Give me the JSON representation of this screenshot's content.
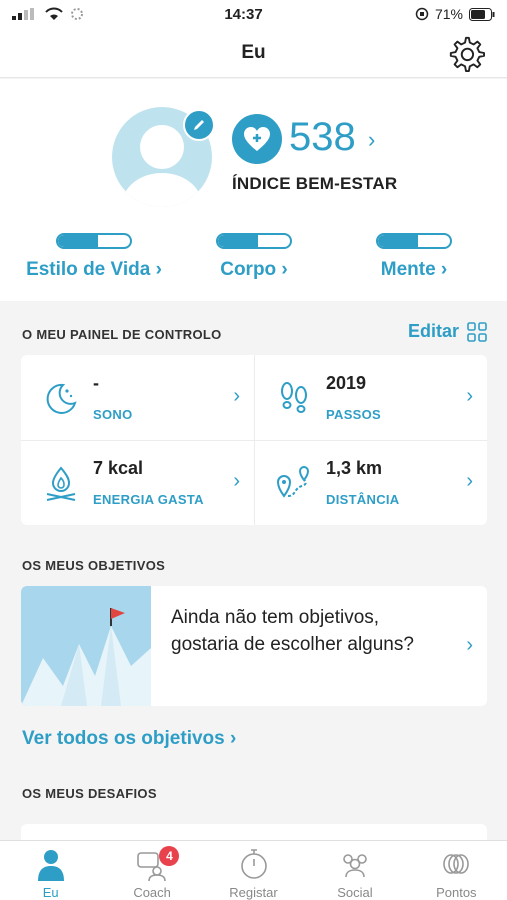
{
  "status": {
    "time": "14:37",
    "battery": "71%"
  },
  "nav": {
    "title": "Eu"
  },
  "profile": {
    "score": "538",
    "score_label": "ÍNDICE BEM-ESTAR"
  },
  "categories": [
    {
      "label": "Estilo de Vida ›",
      "fill": 0.55
    },
    {
      "label": "Corpo ›",
      "fill": 0.55
    },
    {
      "label": "Mente ›",
      "fill": 0.55
    }
  ],
  "dashboard": {
    "title": "O MEU PAINEL DE CONTROLO",
    "edit_label": "Editar",
    "items": [
      {
        "value": "-",
        "label": "SONO",
        "icon": "sleep-icon"
      },
      {
        "value": "2019",
        "label": "PASSOS",
        "icon": "footsteps-icon"
      },
      {
        "value": "7 kcal",
        "label": "ENERGIA GASTA",
        "icon": "fire-icon"
      },
      {
        "value": "1,3 km",
        "label": "DISTÂNCIA",
        "icon": "distance-icon"
      }
    ]
  },
  "goals": {
    "title": "OS MEUS OBJETIVOS",
    "empty_text": "Ainda não tem objetivos, gostaria de escolher alguns?",
    "see_all": "Ver todos os objetivos ›"
  },
  "challenges": {
    "title": "OS MEUS DESAFIOS"
  },
  "tabs": [
    {
      "label": "Eu",
      "icon": "person-icon",
      "active": true
    },
    {
      "label": "Coach",
      "icon": "coach-icon",
      "badge": "4"
    },
    {
      "label": "Registar",
      "icon": "stopwatch-icon"
    },
    {
      "label": "Social",
      "icon": "group-icon"
    },
    {
      "label": "Pontos",
      "icon": "points-icon"
    }
  ],
  "colors": {
    "accent": "#2e9ec7",
    "badge": "#e8424c",
    "avatar_bg": "#bfe3ee"
  }
}
